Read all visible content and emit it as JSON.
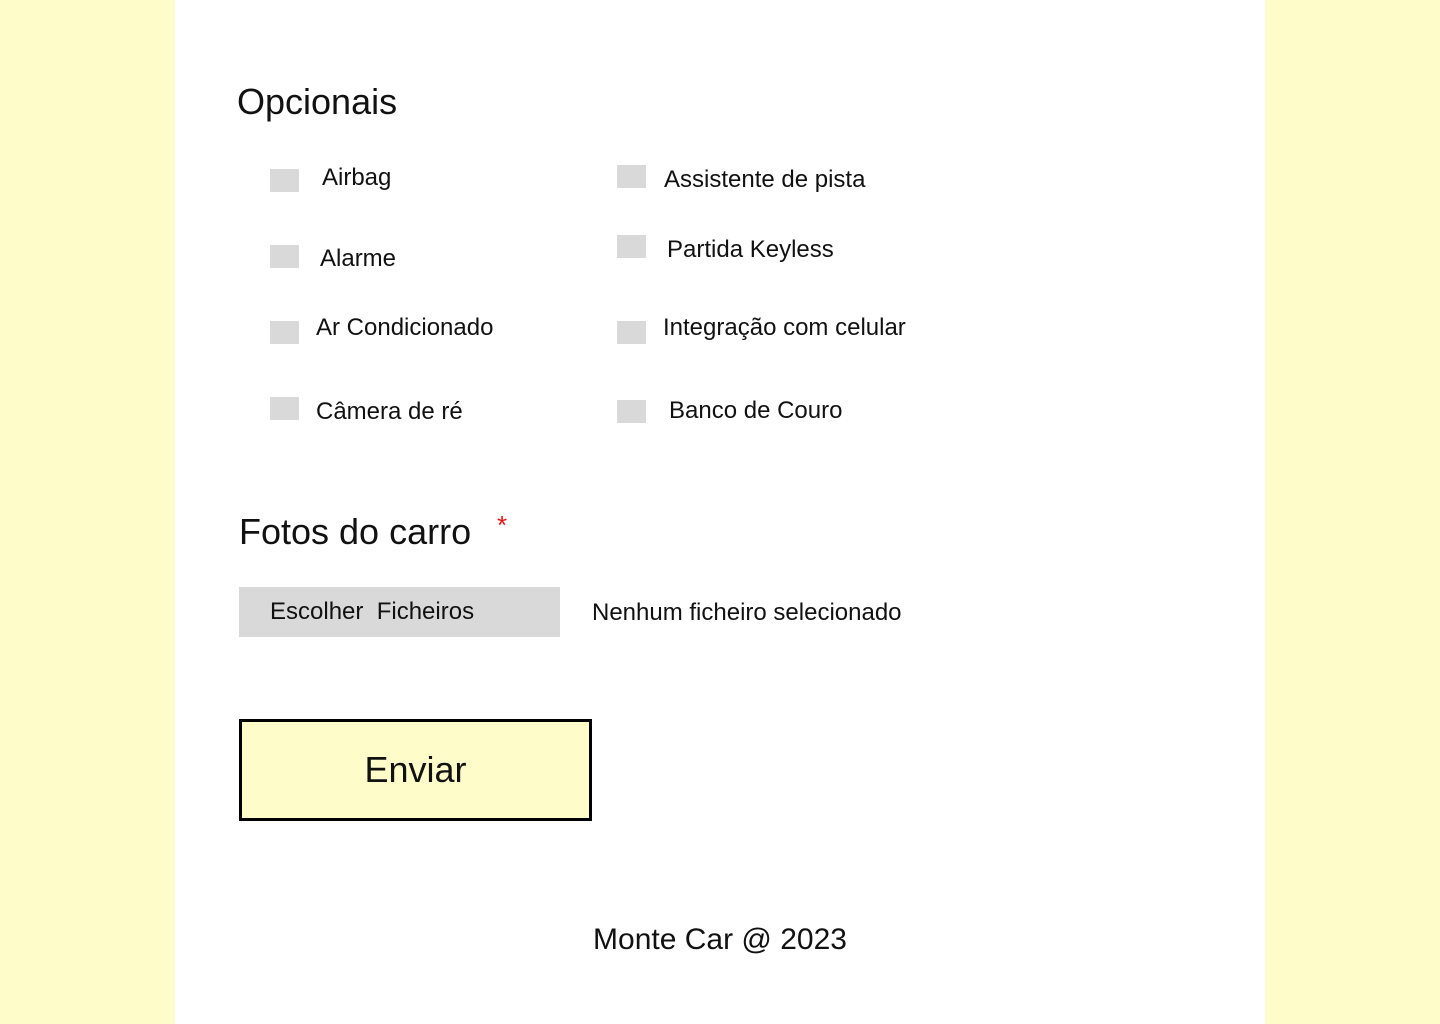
{
  "optionals": {
    "title": "Opcionais",
    "items": [
      {
        "label": "Airbag",
        "checked": false
      },
      {
        "label": "Alarme",
        "checked": false
      },
      {
        "label": "Ar Condicionado",
        "checked": false
      },
      {
        "label": "Câmera de ré",
        "checked": false
      },
      {
        "label": "Assistente de pista",
        "checked": false
      },
      {
        "label": "Partida Keyless",
        "checked": false
      },
      {
        "label": "Integração com celular",
        "checked": false
      },
      {
        "label": "Banco de Couro",
        "checked": false
      }
    ]
  },
  "photos": {
    "title": "Fotos do carro",
    "required_mark": "*",
    "choose_button_label": "Escolher  Ficheiros",
    "status_text": "Nenhum ficheiro selecionado"
  },
  "form": {
    "submit_label": "Enviar"
  },
  "footer": {
    "text": "Monte Car @ 2023"
  },
  "colors": {
    "page_background": "#FEFDC9",
    "panel_background": "#FFFFFF",
    "checkbox": "#D9D9D9",
    "required_star": "#E81515",
    "button_border": "#000000"
  }
}
